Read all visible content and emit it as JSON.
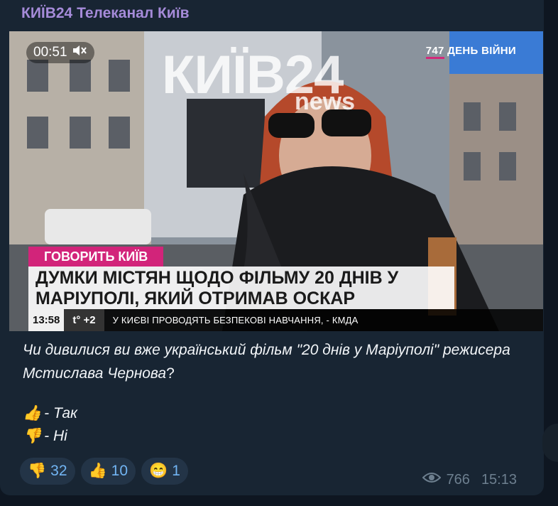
{
  "channel": {
    "title": "КИЇВ24 Телеканал Київ"
  },
  "video": {
    "time": "00:51",
    "day_counter": "747",
    "day_counter_label": "ДЕНЬ ВІЙНИ",
    "logo_main": "КИЇВ24",
    "logo_sub": "news",
    "tag": "ГОВОРИТЬ КИЇВ",
    "headline_line1": "ДУМКИ МІСТЯН ЩОДО ФІЛЬМУ 20 ДНІВ У",
    "headline_line2": "МАРІУПОЛІ, ЯКИЙ ОТРИМАВ ОСКАР",
    "clock": "13:58",
    "temperature": "t° +2",
    "crawl": "У КИЄВІ ПРОВОДЯТЬ БЕЗПЕКОВІ НАВЧАННЯ, - КМДА"
  },
  "caption": {
    "text_italic": "Чи дивилися ви вже український фільм \"20 днів у Маріуполі\" режисера Мстислава Чернова",
    "text_mark": "?"
  },
  "options": [
    {
      "emoji": "👍",
      "label": "- Так"
    },
    {
      "emoji": "👎",
      "label": "- Ні"
    }
  ],
  "reactions": [
    {
      "emoji": "👎",
      "count": "32"
    },
    {
      "emoji": "👍",
      "count": "10"
    },
    {
      "emoji": "😁",
      "count": "1"
    }
  ],
  "meta": {
    "views": "766",
    "time": "15:13"
  },
  "colors": {
    "bg": "#0e1621",
    "bubble": "#182533",
    "accent": "#a58bd9",
    "reaction": "#72b5f4",
    "brand_pink": "#d2247a"
  }
}
